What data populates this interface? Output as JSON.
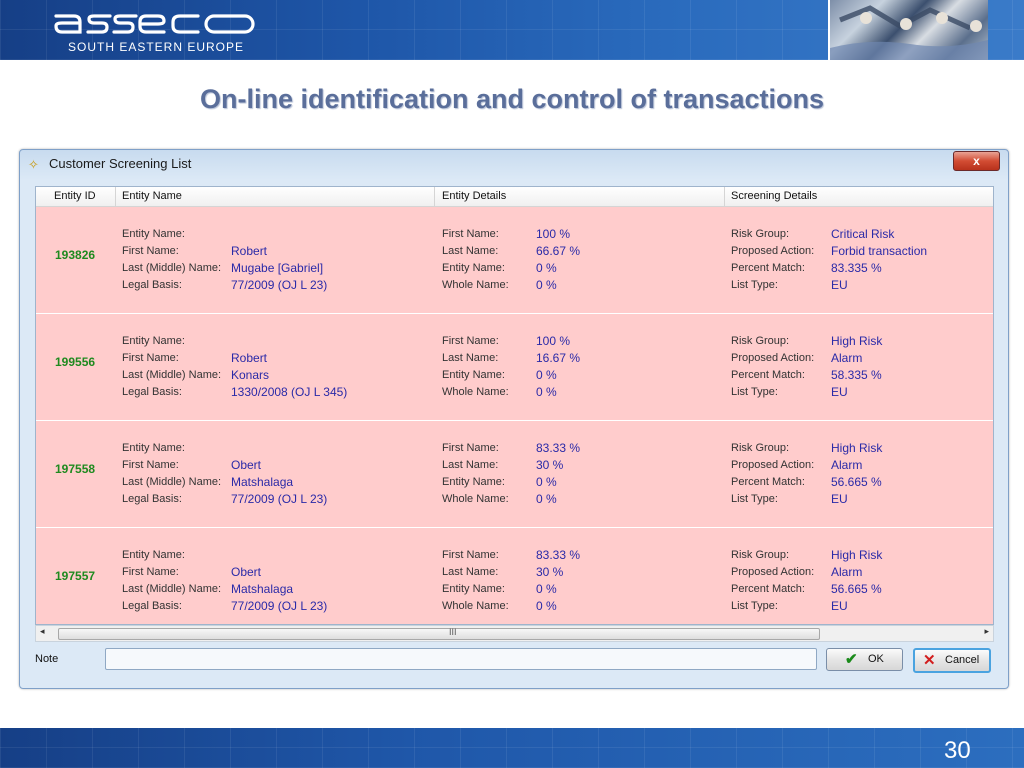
{
  "brand": {
    "sub": "SOUTH EASTERN EUROPE"
  },
  "slide": {
    "title": "On-line identification and control of transactions",
    "page": "30"
  },
  "window": {
    "title": "Customer Screening List",
    "close": "x"
  },
  "columns": {
    "entity_id": "Entity ID",
    "entity_name": "Entity Name",
    "entity_details": "Entity Details",
    "screening_details": "Screening Details"
  },
  "labels": {
    "name": [
      "Entity Name:",
      "First Name:",
      "Last (Middle) Name:",
      "Legal Basis:"
    ],
    "details": [
      "First Name:",
      "Last Name:",
      "Entity Name:",
      "Whole Name:"
    ],
    "screening": [
      "Risk Group:",
      "Proposed Action:",
      "Percent Match:",
      "List Type:"
    ]
  },
  "rows": [
    {
      "id": "193826",
      "first": "Robert",
      "last": "Mugabe [Gabriel]",
      "legal": "77/2009 (OJ L 23)",
      "d_first": "100 %",
      "d_last": "66.67 %",
      "d_entity": "0 %",
      "d_whole": "0 %",
      "risk": "Critical Risk",
      "action": "Forbid transaction",
      "match": "83.335 %",
      "list": "EU"
    },
    {
      "id": "199556",
      "first": "Robert",
      "last": "Konars",
      "legal": "1330/2008 (OJ L 345)",
      "d_first": "100 %",
      "d_last": "16.67 %",
      "d_entity": "0 %",
      "d_whole": "0 %",
      "risk": "High Risk",
      "action": "Alarm",
      "match": "58.335 %",
      "list": "EU"
    },
    {
      "id": "197558",
      "first": "Obert",
      "last": "Matshalaga",
      "legal": "77/2009 (OJ L 23)",
      "d_first": "83.33 %",
      "d_last": "30 %",
      "d_entity": "0 %",
      "d_whole": "0 %",
      "risk": "High Risk",
      "action": "Alarm",
      "match": "56.665 %",
      "list": "EU"
    },
    {
      "id": "197557",
      "first": "Obert",
      "last": "Matshalaga",
      "legal": "77/2009 (OJ L 23)",
      "d_first": "83.33 %",
      "d_last": "30 %",
      "d_entity": "0 %",
      "d_whole": "0 %",
      "risk": "High Risk",
      "action": "Alarm",
      "match": "56.665 %",
      "list": "EU"
    }
  ],
  "scroll": {
    "grip": "III",
    "left": "◂",
    "right": "▸"
  },
  "note": {
    "label": "Note",
    "value": ""
  },
  "buttons": {
    "ok": "OK",
    "cancel": "Cancel",
    "ok_icon": "✔",
    "cancel_icon": "✕"
  },
  "icons": {
    "window": "✧"
  },
  "colors": {
    "row_bg": "#ffcccc",
    "id_color": "#1f8a1f",
    "value_color": "#2a2aa8",
    "band": "#1e56a8"
  }
}
